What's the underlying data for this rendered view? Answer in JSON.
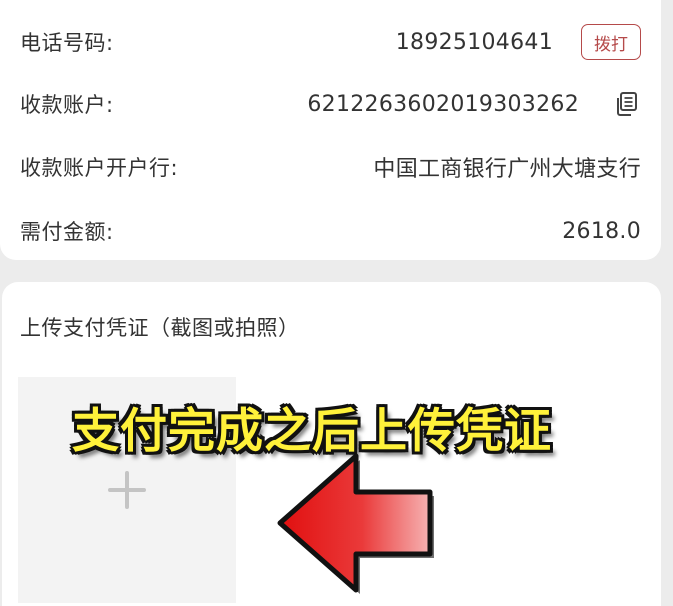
{
  "payment_info": {
    "rows": [
      {
        "label": "电话号码:",
        "value": "18925104641",
        "action_label": "拨打"
      },
      {
        "label": "收款账户:",
        "value": "6212263602019303262",
        "action_icon": "copy-icon"
      },
      {
        "label": "收款账户开户行:",
        "value": "中国工商银行广州大塘支行"
      },
      {
        "label": "需付金额:",
        "value": "2618.0"
      }
    ]
  },
  "upload": {
    "title": "上传支付凭证（截图或拍照）",
    "add_icon": "plus-icon"
  },
  "overlay": {
    "caption": "支付完成之后上传凭证",
    "caption_color": "#fff13a",
    "arrow_color": "#e31b1b",
    "arrow_icon": "left-arrow-icon"
  },
  "colors": {
    "accent": "#b54a4a",
    "background": "#ececec",
    "card": "#ffffff"
  }
}
